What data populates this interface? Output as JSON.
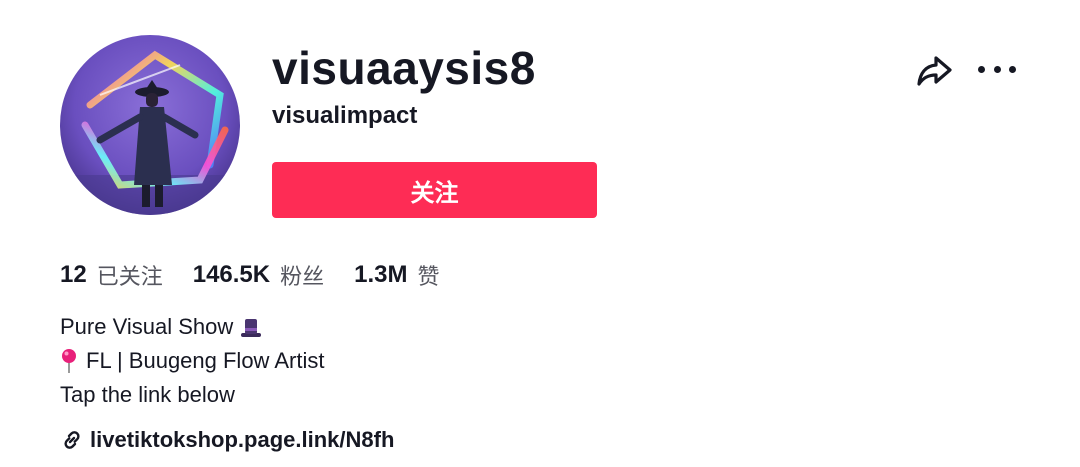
{
  "profile": {
    "username": "visuaaysis8",
    "nickname": "visualimpact",
    "follow_label": "关注",
    "avatar_icon": "avatar-photo"
  },
  "stats": [
    {
      "value": "12",
      "label": "已关注"
    },
    {
      "value": "146.5K",
      "label": "粉丝"
    },
    {
      "value": "1.3M",
      "label": "赞"
    }
  ],
  "bio": {
    "line1": "Pure Visual Show",
    "line1_emoji": "top-hat-icon",
    "line2": "FL | Buugeng Flow Artist",
    "line2_emoji": "round-pushpin-icon",
    "line3": "Tap the link below"
  },
  "link": {
    "text": "livetiktokshop.page.link/N8fh",
    "icon": "link-icon"
  },
  "actions": {
    "share_icon": "share-icon",
    "more_icon": "more-icon"
  },
  "colors": {
    "accent": "#fe2c55",
    "text_primary": "#161823",
    "text_secondary": "#55565f"
  }
}
